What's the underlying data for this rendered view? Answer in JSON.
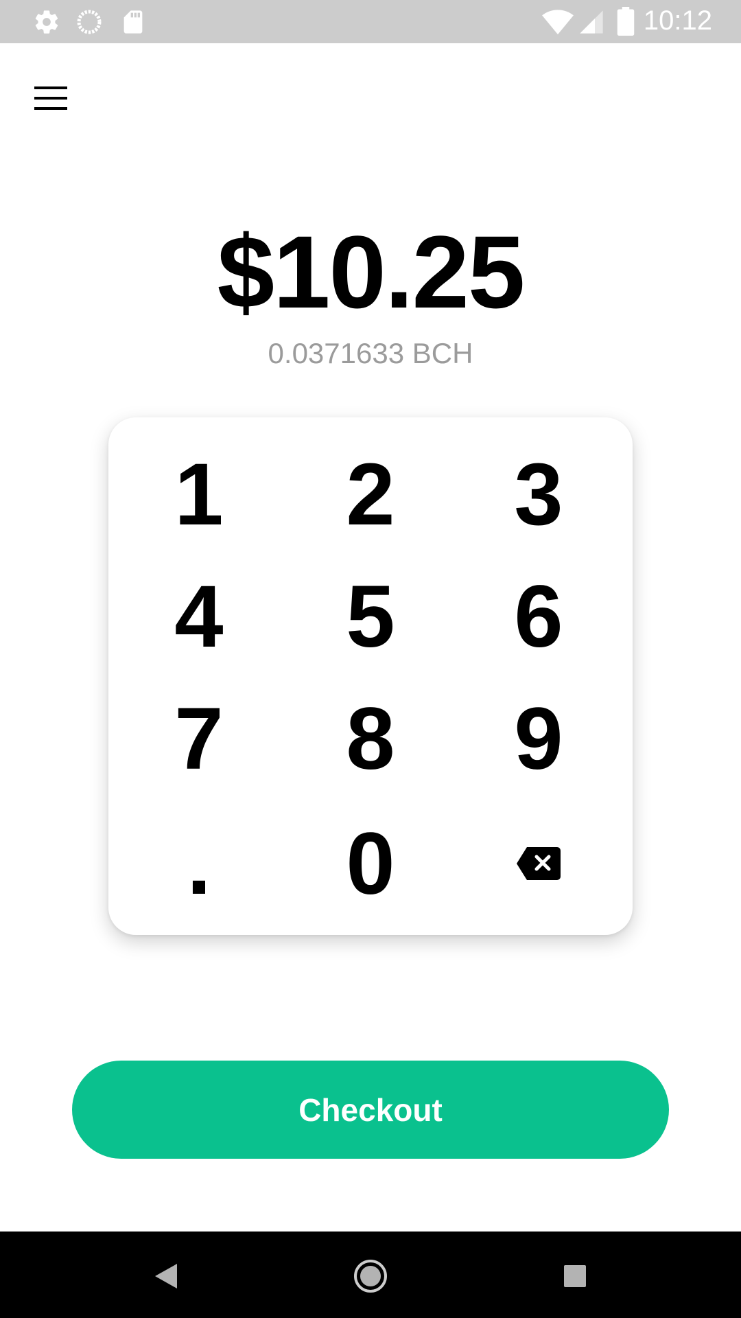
{
  "status_bar": {
    "time": "10:12",
    "icons": [
      "gear-icon",
      "sync-icon",
      "sd-card-icon",
      "wifi-icon",
      "cell-signal-icon",
      "battery-icon"
    ]
  },
  "header": {
    "menu_icon": "hamburger-menu-icon"
  },
  "amount": {
    "fiat": "$10.25",
    "crypto": "0.0371633 BCH"
  },
  "keypad": {
    "keys": [
      "1",
      "2",
      "3",
      "4",
      "5",
      "6",
      "7",
      "8",
      "9",
      ".",
      "0"
    ],
    "backspace_icon": "backspace-icon"
  },
  "checkout": {
    "label": "Checkout",
    "color": "#0ac18e"
  },
  "nav_bar": {
    "icons": [
      "back-icon",
      "home-icon",
      "recents-icon"
    ]
  }
}
